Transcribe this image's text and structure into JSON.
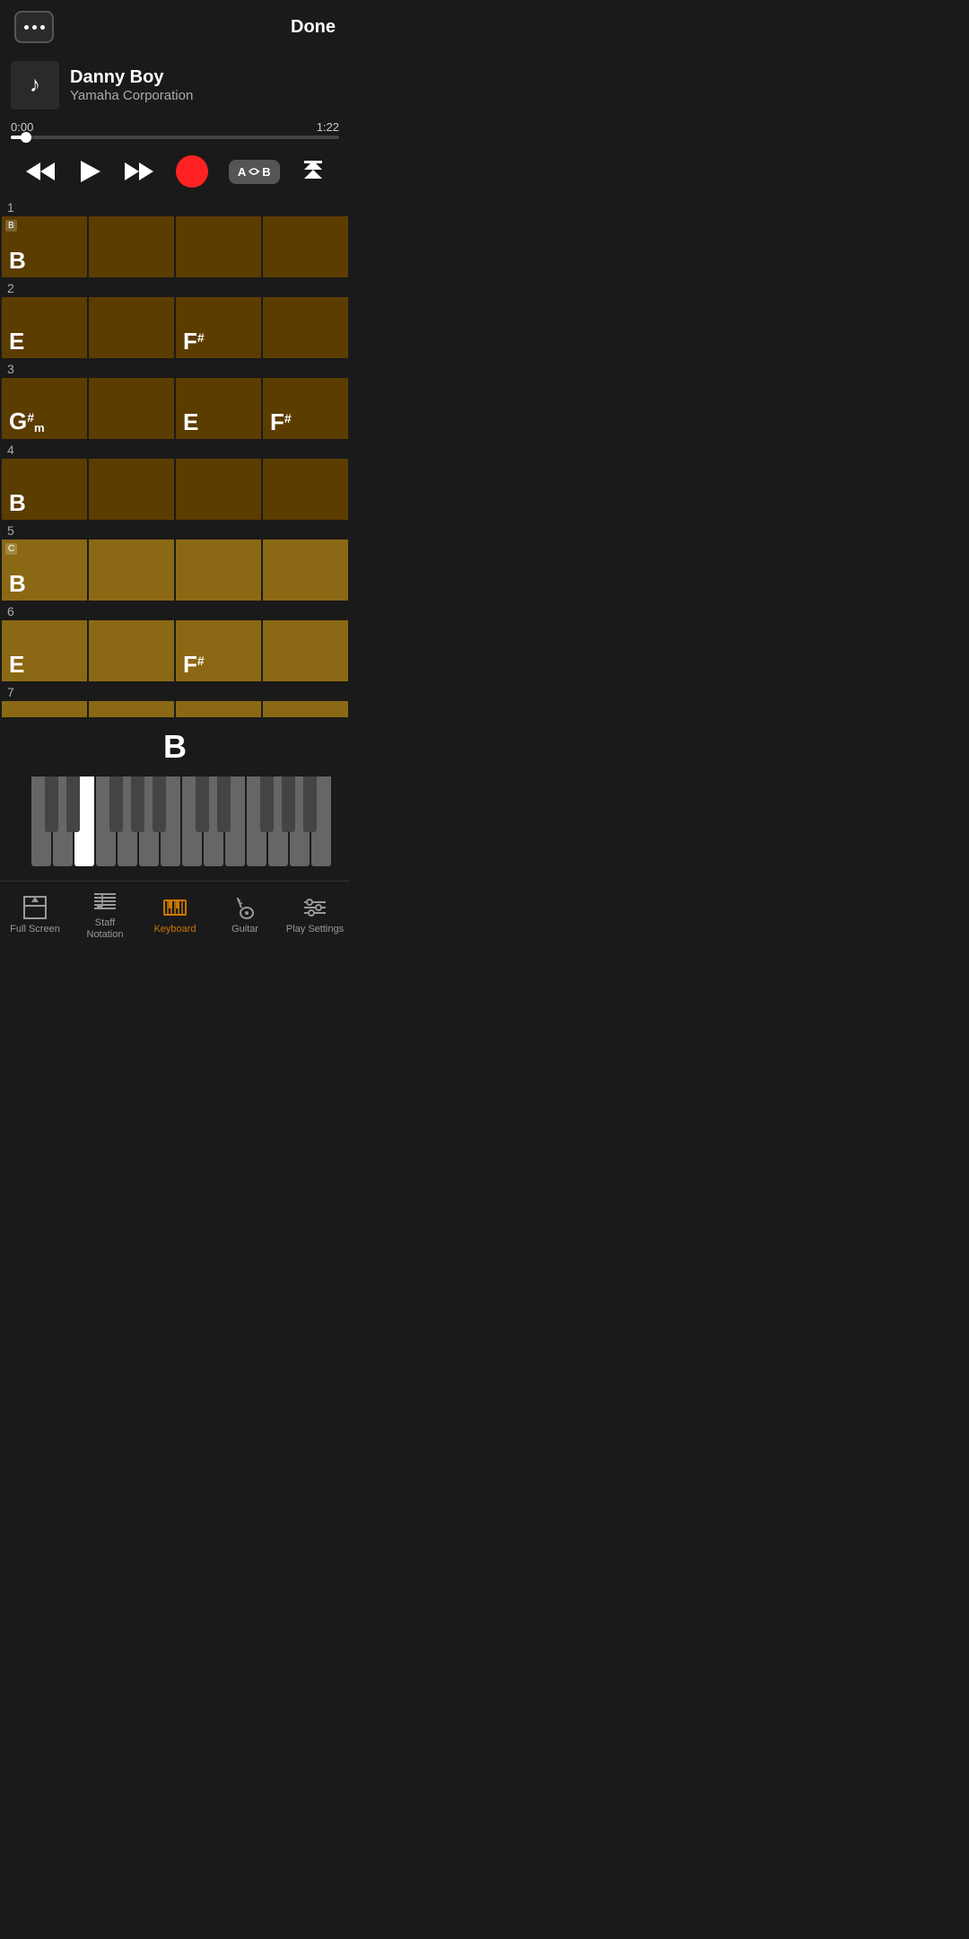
{
  "header": {
    "menu_label": "...",
    "done_label": "Done"
  },
  "player": {
    "track_title": "Danny Boy",
    "track_artist": "Yamaha Corporation",
    "time_current": "0:00",
    "time_total": "1:22",
    "progress_percent": 3
  },
  "transport": {
    "rewind_label": "⏮",
    "play_label": "▶",
    "ff_label": "⏭",
    "ab_label": "AB",
    "score_top_label": "⏫"
  },
  "measures": [
    {
      "number": "1",
      "section": "B",
      "chords": [
        "B",
        "",
        "",
        ""
      ]
    },
    {
      "number": "2",
      "section": null,
      "chords": [
        "E",
        "",
        "F#",
        ""
      ]
    },
    {
      "number": "3",
      "section": null,
      "chords": [
        "G#m",
        "",
        "E",
        "F#"
      ]
    },
    {
      "number": "4",
      "section": null,
      "chords": [
        "B",
        "",
        "",
        ""
      ]
    },
    {
      "number": "5",
      "section": "C",
      "chords": [
        "B",
        "",
        "",
        ""
      ]
    },
    {
      "number": "6",
      "section": null,
      "chords": [
        "E",
        "",
        "F#",
        ""
      ]
    },
    {
      "number": "7",
      "section": null,
      "chords": [
        "",
        "",
        "",
        ""
      ]
    }
  ],
  "current_chord": "B",
  "tab_bar": {
    "items": [
      {
        "id": "fullscreen",
        "label": "Full Screen",
        "icon": "fullscreen"
      },
      {
        "id": "staff",
        "label": "Staff\nNotation",
        "icon": "staff"
      },
      {
        "id": "keyboard",
        "label": "Keyboard",
        "icon": "keyboard",
        "active": true
      },
      {
        "id": "guitar",
        "label": "Guitar",
        "icon": "guitar"
      },
      {
        "id": "playsettings",
        "label": "Play Settings",
        "icon": "playsettings"
      }
    ]
  },
  "colors": {
    "accent": "#cc7700",
    "chord_dark": "#5c3d00",
    "chord_medium": "#7a5200",
    "chord_light": "#8b6914",
    "record_red": "#ff2222"
  }
}
